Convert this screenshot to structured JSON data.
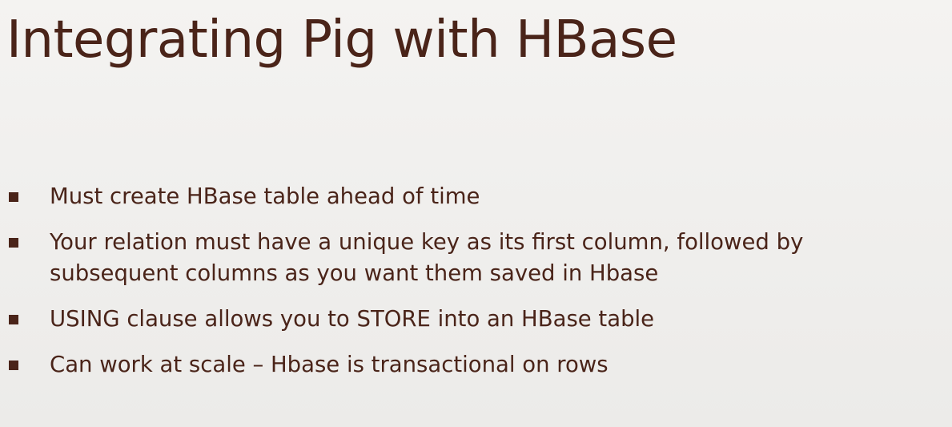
{
  "slide": {
    "title": "Integrating Pig with HBase",
    "bullets": [
      {
        "lines": [
          "Must create HBase table ahead of time"
        ]
      },
      {
        "lines": [
          "Your relation must have a unique key as its first column, followed by",
          "subsequent columns as you want them saved in Hbase"
        ]
      },
      {
        "lines": [
          "USING clause allows you to STORE into an HBase table"
        ]
      },
      {
        "lines": [
          "Can work at scale – Hbase is transactional on rows"
        ]
      }
    ],
    "colors": {
      "text": "#4a2419",
      "background": "#efeeec"
    },
    "icons": {
      "bullet": "square-bullet-icon"
    }
  }
}
